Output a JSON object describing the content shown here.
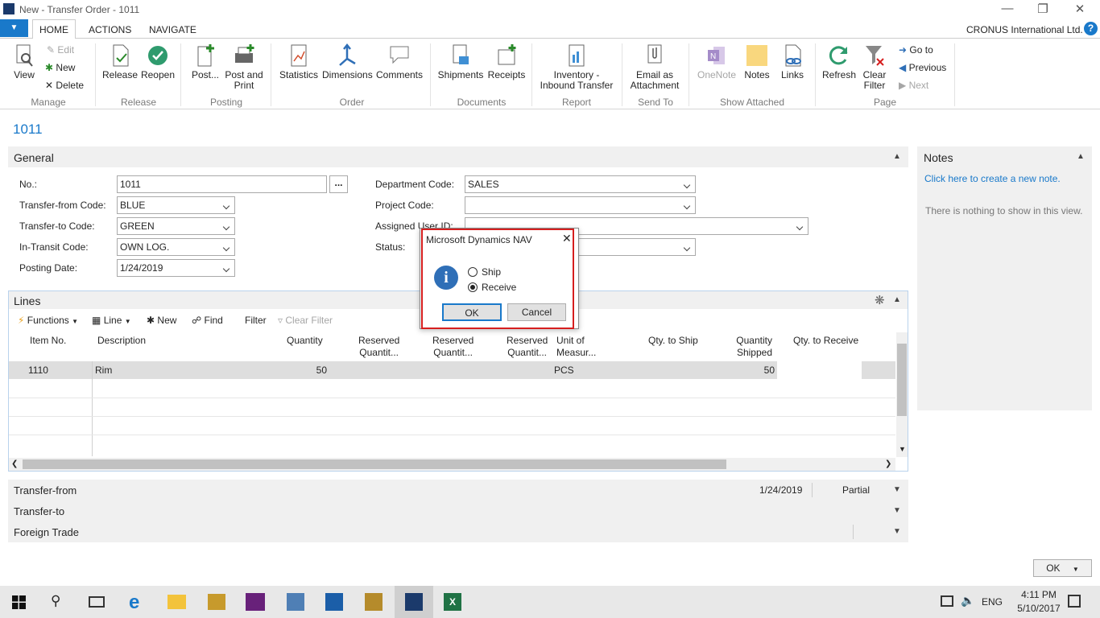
{
  "window": {
    "title": "New - Transfer Order - 1011",
    "company": "CRONUS International Ltd."
  },
  "tabs": [
    {
      "label": "HOME"
    },
    {
      "label": "ACTIONS"
    },
    {
      "label": "NAVIGATE"
    }
  ],
  "ribbon": {
    "manage": {
      "group": "Manage",
      "view": "View",
      "edit": "Edit",
      "new": "New",
      "delete": "Delete"
    },
    "release": {
      "group": "Release",
      "release": "Release",
      "reopen": "Reopen"
    },
    "posting": {
      "group": "Posting",
      "post": "Post...",
      "post_print_1": "Post and",
      "post_print_2": "Print"
    },
    "order": {
      "group": "Order",
      "statistics": "Statistics",
      "dimensions": "Dimensions",
      "comments": "Comments"
    },
    "documents": {
      "group": "Documents",
      "shipments": "Shipments",
      "receipts": "Receipts"
    },
    "report": {
      "group": "Report",
      "inv_1": "Inventory -",
      "inv_2": "Inbound Transfer"
    },
    "sendto": {
      "group": "Send To",
      "email_1": "Email as",
      "email_2": "Attachment"
    },
    "show_attached": {
      "group": "Show Attached",
      "onenote": "OneNote",
      "notes": "Notes",
      "links": "Links"
    },
    "page": {
      "group": "Page",
      "refresh": "Refresh",
      "clear_1": "Clear",
      "clear_2": "Filter",
      "goto": "Go to",
      "previous": "Previous",
      "next": "Next"
    }
  },
  "page_id": "1011",
  "general": {
    "title": "General",
    "no_label": "No.:",
    "no_value": "1011",
    "no_btn": "...",
    "from_label": "Transfer-from Code:",
    "from_value": "BLUE",
    "to_label": "Transfer-to Code:",
    "to_value": "GREEN",
    "transit_label": "In-Transit Code:",
    "transit_value": "OWN LOG.",
    "posting_label": "Posting Date:",
    "posting_value": "1/24/2019",
    "dept_label": "Department Code:",
    "dept_value": "SALES",
    "project_label": "Project Code:",
    "project_value": "",
    "assigned_label": "Assigned User ID:",
    "assigned_value": "",
    "status_label": "Status:",
    "status_value": ""
  },
  "notes": {
    "title": "Notes",
    "create": "Click here to create a new note.",
    "empty": "There is nothing to show in this view."
  },
  "lines": {
    "title": "Lines",
    "toolbar": {
      "functions": "Functions",
      "line": "Line",
      "new": "New",
      "find": "Find",
      "filter": "Filter",
      "clear_filter": "Clear Filter"
    },
    "headers": {
      "item_no": "Item No.",
      "description": "Description",
      "quantity": "Quantity",
      "res1_a": "Reserved",
      "res1_b": "Quantit...",
      "res2_a": "Reserved",
      "res2_b": "Quantit...",
      "res3_a": "Reserved",
      "res3_b": "Quantit...",
      "uom_a": "Unit of",
      "uom_b": "Measur...",
      "qty_ship": "Qty. to Ship",
      "qty_shipped_a": "Quantity",
      "qty_shipped_b": "Shipped",
      "qty_receive": "Qty. to Receive"
    },
    "rows": [
      {
        "item_no": "1110",
        "description": "Rim",
        "quantity": "50",
        "uom": "PCS",
        "qty_shipped": "50"
      }
    ]
  },
  "sections": {
    "transfer_from": "Transfer-from",
    "transfer_from_date": "1/24/2019",
    "transfer_from_status": "Partial",
    "transfer_to": "Transfer-to",
    "foreign_trade": "Foreign Trade"
  },
  "ok_button": "OK",
  "dialog": {
    "title": "Microsoft Dynamics NAV",
    "option_ship": "Ship",
    "option_receive": "Receive",
    "selected": "Receive",
    "ok": "OK",
    "cancel": "Cancel"
  },
  "taskbar": {
    "lang": "ENG",
    "time": "4:11 PM",
    "date": "5/10/2017"
  }
}
